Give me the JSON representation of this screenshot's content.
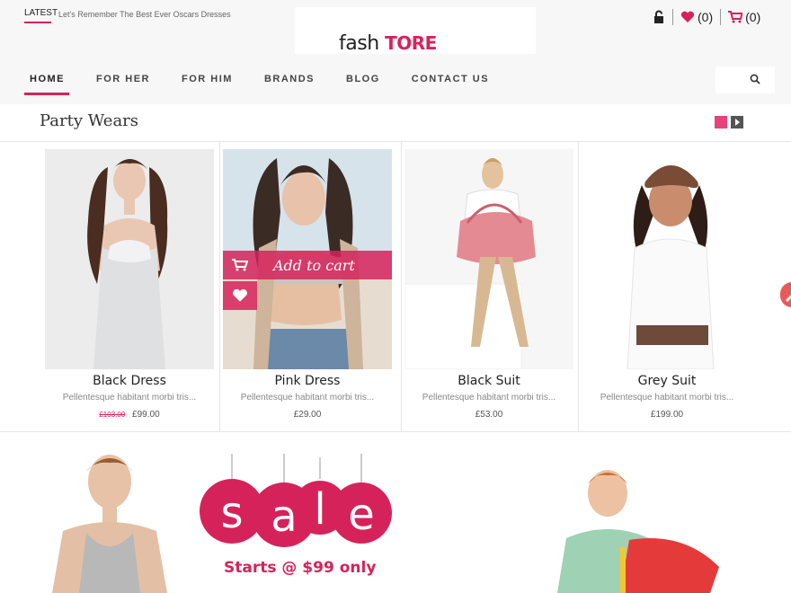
{
  "header": {
    "latest_label": "LATEST",
    "latest_text": "Let's Remember The Best Ever Oscars Dresses",
    "logo_part1": "fash",
    "logo_part2": "TORE",
    "wishlist_count": "(0)",
    "cart_count": "(0)"
  },
  "icons": {
    "lock": "lock-icon",
    "heart": "heart-icon",
    "cart": "cart-icon",
    "search": "search-icon"
  },
  "nav": {
    "items": [
      "HOME",
      "FOR HER",
      "FOR HIM",
      "BRANDS",
      "BLOG",
      "CONTACT US"
    ]
  },
  "section": {
    "title": "Party Wears"
  },
  "products": [
    {
      "name": "Black Dress",
      "desc": "Pellentesque habitant morbi tris...",
      "old_price": "£103.00",
      "price": "£99.00"
    },
    {
      "name": "Pink Dress",
      "desc": "Pellentesque habitant morbi tris...",
      "old_price": "",
      "price": "£29.00"
    },
    {
      "name": "Black Suit",
      "desc": "Pellentesque habitant morbi tris...",
      "old_price": "",
      "price": "£53.00"
    },
    {
      "name": "Grey Suit",
      "desc": "Pellentesque habitant morbi tris...",
      "old_price": "",
      "price": "£199.00"
    }
  ],
  "hover": {
    "add_to_cart": "Add to cart"
  },
  "promo": {
    "sale_letters": [
      "s",
      "a",
      "l",
      "e"
    ],
    "starts_text": "Starts @ $99 only"
  },
  "colors": {
    "accent": "#d6225b",
    "muted": "#888888"
  }
}
